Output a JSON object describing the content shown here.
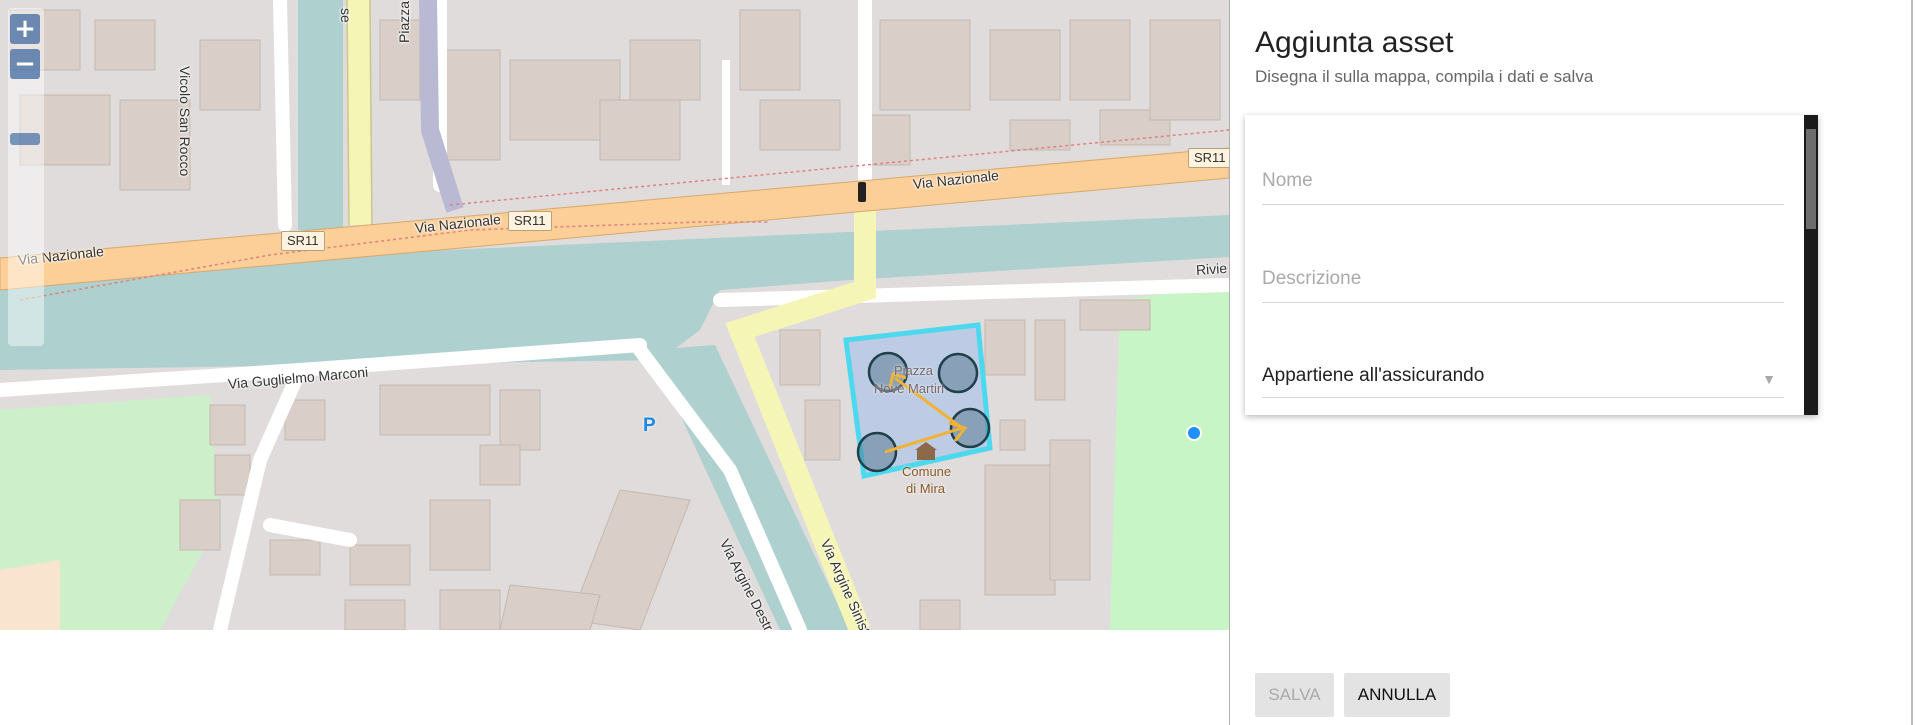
{
  "map": {
    "zoom_in": "+",
    "zoom_out": "−",
    "streets": {
      "vicolo_san_rocco": "Vicolo San Rocco",
      "piazza_giacinto": "Piazza Giacin",
      "se": "se",
      "via_nazionale": "Via Nazionale",
      "via_marconi": "Via Guglielmo Marconi",
      "via_argine_destro": "Via Argine Destro N",
      "via_argine_sinistro": "Via Argine Sinistro N",
      "riviera": "Rivie"
    },
    "badges": {
      "sr11": "SR11"
    },
    "poi": {
      "piazza": "Piazza",
      "nove_martiri": "Nove Martiri",
      "comune": "Comune",
      "di_mira": "di Mira",
      "parking": "P"
    },
    "colors": {
      "major_road": "#fccf98",
      "secondary_road": "#f5f5b5",
      "canal": "#aed0cf",
      "park": "#c8f5c6",
      "building": "#d9cfc8",
      "selection": "#4cd9ee",
      "arrow": "#f2b233",
      "location_dot": "#1e90ff"
    }
  },
  "panel": {
    "title": "Aggiunta asset",
    "subtitle": "Disegna il sulla mappa, compila i dati e salva",
    "form": {
      "name_placeholder": "Nome",
      "description_placeholder": "Descrizione",
      "owner_select": "Appartiene all'assicurando"
    },
    "buttons": {
      "save": "SALVA",
      "cancel": "ANNULLA"
    }
  }
}
